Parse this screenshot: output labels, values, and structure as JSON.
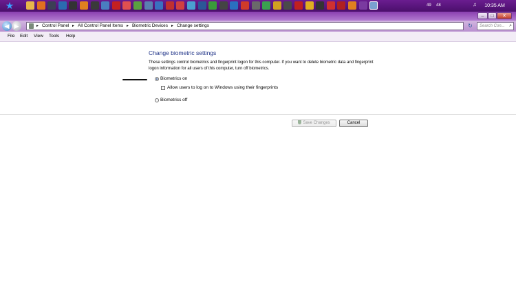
{
  "taskbar": {
    "clock": "10:35 AM",
    "tray_numbers": [
      "49",
      "48"
    ],
    "icons": [
      {
        "name": "folder-icon",
        "color": "#e7b64a"
      },
      {
        "name": "firefox-icon",
        "color": "#e0701f"
      },
      {
        "name": "steam-icon",
        "color": "#3b3f55"
      },
      {
        "name": "photoshop-icon",
        "color": "#2a6bb0"
      },
      {
        "name": "app-icon",
        "color": "#333333"
      },
      {
        "name": "illustrator-icon",
        "color": "#e0821f"
      },
      {
        "name": "video-icon",
        "color": "#3a3a3a"
      },
      {
        "name": "visio-icon",
        "color": "#4a7ec0"
      },
      {
        "name": "acrobat-icon",
        "color": "#c42020"
      },
      {
        "name": "pdf-icon",
        "color": "#e05050"
      },
      {
        "name": "pen-icon",
        "color": "#5aa040"
      },
      {
        "name": "map-icon",
        "color": "#5a80b0"
      },
      {
        "name": "globe-icon",
        "color": "#3a70c0"
      },
      {
        "name": "media-icon",
        "color": "#c03030"
      },
      {
        "name": "calendar-icon",
        "color": "#d04040"
      },
      {
        "name": "image-icon",
        "color": "#4aa0d0"
      },
      {
        "name": "word-icon",
        "color": "#2b5797"
      },
      {
        "name": "maps-icon",
        "color": "#3a9a3a"
      },
      {
        "name": "eye-icon",
        "color": "#444444"
      },
      {
        "name": "network-icon",
        "color": "#2a70c0"
      },
      {
        "name": "chart-icon",
        "color": "#cf3b2a"
      },
      {
        "name": "calculator-icon",
        "color": "#6a6a6a"
      },
      {
        "name": "game-icon",
        "color": "#3aa050"
      },
      {
        "name": "camera-icon",
        "color": "#d0a020"
      },
      {
        "name": "phone-icon",
        "color": "#4a4a4a"
      },
      {
        "name": "opera-icon",
        "color": "#c02020"
      },
      {
        "name": "circle-icon",
        "color": "#e0b020"
      },
      {
        "name": "star-icon",
        "color": "#333333"
      },
      {
        "name": "stop-icon",
        "color": "#d03030"
      },
      {
        "name": "blocked-icon",
        "color": "#b02020"
      },
      {
        "name": "pie-icon",
        "color": "#e08020"
      },
      {
        "name": "bolt-icon",
        "color": "#7a3aa0"
      },
      {
        "name": "control-panel-icon",
        "color": "#7aa0d0"
      }
    ]
  },
  "window": {
    "minimize_label": "–",
    "maximize_label": "□",
    "close_label": "✕"
  },
  "address": {
    "crumbs": [
      "Control Panel",
      "All Control Panel Items",
      "Biometric Devices",
      "Change settings"
    ],
    "separator": "▸",
    "search_placeholder": "Search Con...",
    "refresh_glyph": "↻",
    "search_glyph": "⌕"
  },
  "menu": {
    "items": [
      "File",
      "Edit",
      "View",
      "Tools",
      "Help"
    ]
  },
  "content": {
    "title": "Change biometric settings",
    "description": "These settings control biometrics and fingerprint logon for this computer. If you want to delete biometric data and fingerprint logon information for all users of this computer, turn off biometrics.",
    "biometrics_on_label": "Biometrics on",
    "allow_logon_label": "Allow users to log on to Windows using their fingerprints",
    "biometrics_off_label": "Biometrics off",
    "biometrics_on_selected": true,
    "allow_logon_checked": false
  },
  "buttons": {
    "save_label": "Save Changes",
    "cancel_label": "Cancel"
  }
}
